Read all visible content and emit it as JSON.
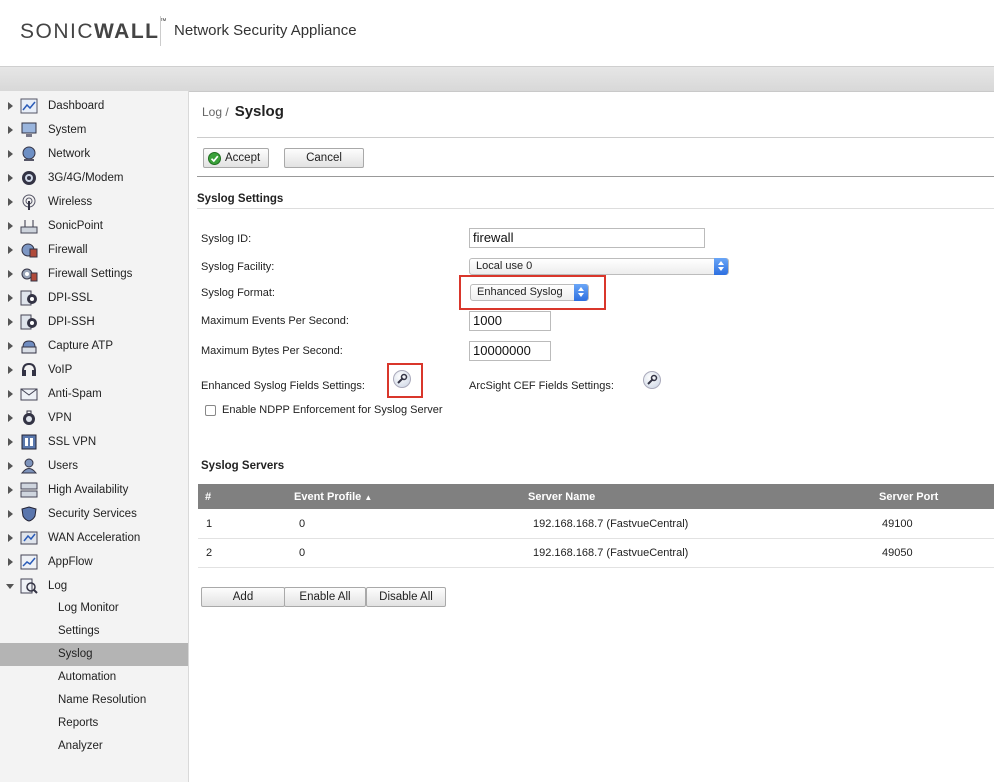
{
  "header": {
    "brand_light": "SONIC",
    "brand_bold": "WALL",
    "brand_tm": "™",
    "product": "Network Security Appliance"
  },
  "sidebar": {
    "items": [
      {
        "label": "Dashboard"
      },
      {
        "label": "System"
      },
      {
        "label": "Network"
      },
      {
        "label": "3G/4G/Modem"
      },
      {
        "label": "Wireless"
      },
      {
        "label": "SonicPoint"
      },
      {
        "label": "Firewall"
      },
      {
        "label": "Firewall Settings"
      },
      {
        "label": "DPI-SSL"
      },
      {
        "label": "DPI-SSH"
      },
      {
        "label": "Capture ATP"
      },
      {
        "label": "VoIP"
      },
      {
        "label": "Anti-Spam"
      },
      {
        "label": "VPN"
      },
      {
        "label": "SSL VPN"
      },
      {
        "label": "Users"
      },
      {
        "label": "High Availability"
      },
      {
        "label": "Security Services"
      },
      {
        "label": "WAN Acceleration"
      },
      {
        "label": "AppFlow"
      },
      {
        "label": "Log"
      }
    ],
    "log_sub": [
      {
        "label": "Log Monitor"
      },
      {
        "label": "Settings"
      },
      {
        "label": "Syslog"
      },
      {
        "label": "Automation"
      },
      {
        "label": "Name Resolution"
      },
      {
        "label": "Reports"
      },
      {
        "label": "Analyzer"
      }
    ]
  },
  "breadcrumb": {
    "parent": "Log /",
    "current": "Syslog"
  },
  "toolbar": {
    "accept": "Accept",
    "cancel": "Cancel"
  },
  "settings": {
    "title": "Syslog Settings",
    "syslog_id_label": "Syslog ID:",
    "syslog_id_value": "firewall",
    "facility_label": "Syslog Facility:",
    "facility_value": "Local use 0",
    "format_label": "Syslog Format:",
    "format_value": "Enhanced Syslog",
    "max_events_label": "Maximum Events Per Second:",
    "max_events_value": "1000",
    "max_bytes_label": "Maximum Bytes Per Second:",
    "max_bytes_value": "10000000",
    "enhanced_fields_label": "Enhanced Syslog Fields Settings:",
    "arcsight_label": "ArcSight CEF Fields Settings:",
    "ndpp_label": "Enable NDPP Enforcement for Syslog Server"
  },
  "servers": {
    "title": "Syslog Servers",
    "columns": [
      "#",
      "Event Profile",
      "Server Name",
      "Server Port"
    ],
    "rows": [
      {
        "num": "1",
        "profile": "0",
        "name": "192.168.168.7 (FastvueCentral)",
        "port": "49100"
      },
      {
        "num": "2",
        "profile": "0",
        "name": "192.168.168.7 (FastvueCentral)",
        "port": "49050"
      }
    ],
    "add": "Add",
    "enable_all": "Enable All",
    "disable_all": "Disable All"
  },
  "colors": {
    "highlight": "#d9362b",
    "table_header": "#808080",
    "active_nav": "#b4b4b4",
    "accept_check": "#3aa13a"
  }
}
